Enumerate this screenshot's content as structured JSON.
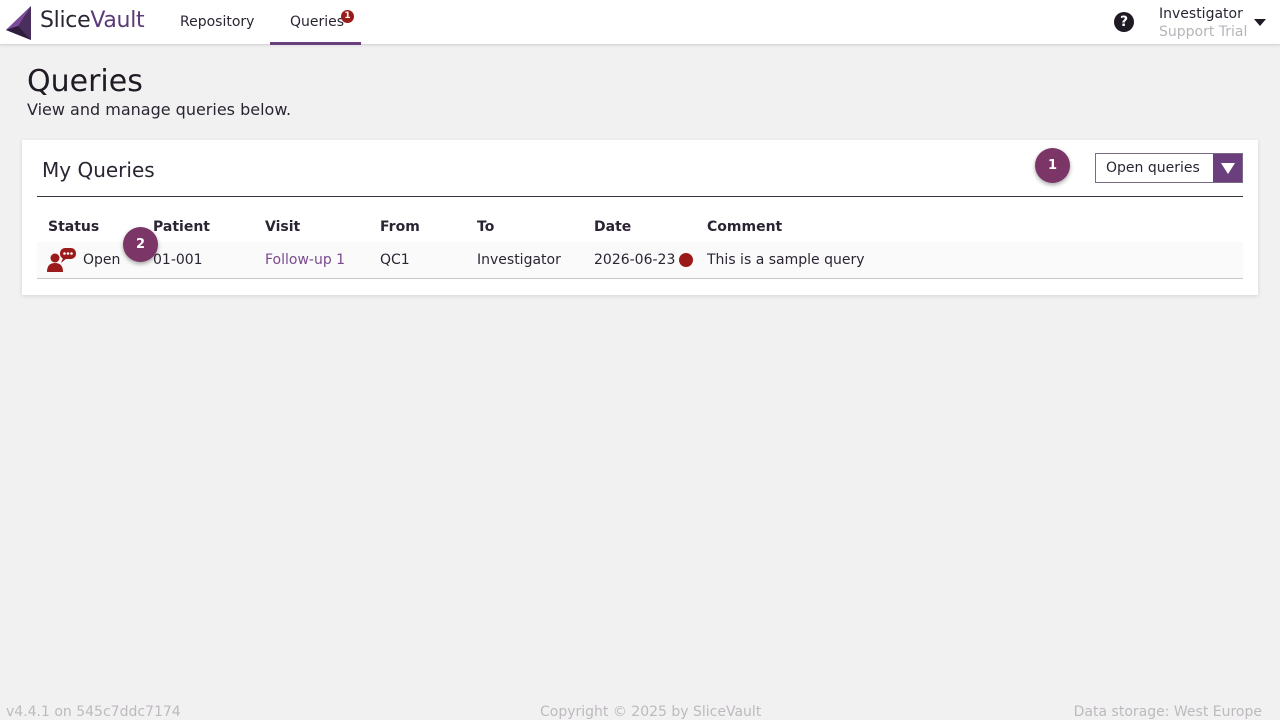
{
  "header": {
    "brand_part1": "Slice",
    "brand_part2": "Vault",
    "nav": [
      {
        "label": "Repository"
      },
      {
        "label": "Queries",
        "badge": "1"
      }
    ],
    "help_icon": "question-icon",
    "user": {
      "name": "Investigator",
      "subtitle": "Support Trial"
    }
  },
  "page": {
    "title": "Queries",
    "subtitle": "View and manage queries below."
  },
  "card": {
    "title": "My Queries",
    "filter": {
      "selected": "Open queries"
    },
    "markers": [
      "1",
      "2"
    ],
    "columns": [
      "Status",
      "Patient",
      "Visit",
      "From",
      "To",
      "Date",
      "Comment"
    ],
    "rows": [
      {
        "status": "Open",
        "status_icon": "open-query-icon",
        "patient": "01-001",
        "visit": "Follow-up 1",
        "from": "QC1",
        "to": "Investigator",
        "date": "2026-06-23",
        "priority_color": "#9b1a1a",
        "comment": "This is a sample query"
      }
    ]
  },
  "footer": {
    "version": "v4.4.1 on 545c7ddc7174",
    "copyright": "Copyright © 2025 by SliceVault",
    "storage": "Data storage: West Europe"
  },
  "colors": {
    "accent": "#6b3f7e",
    "marker": "#7b3566",
    "alert": "#9b1a1a",
    "background": "#f2f1f1"
  }
}
